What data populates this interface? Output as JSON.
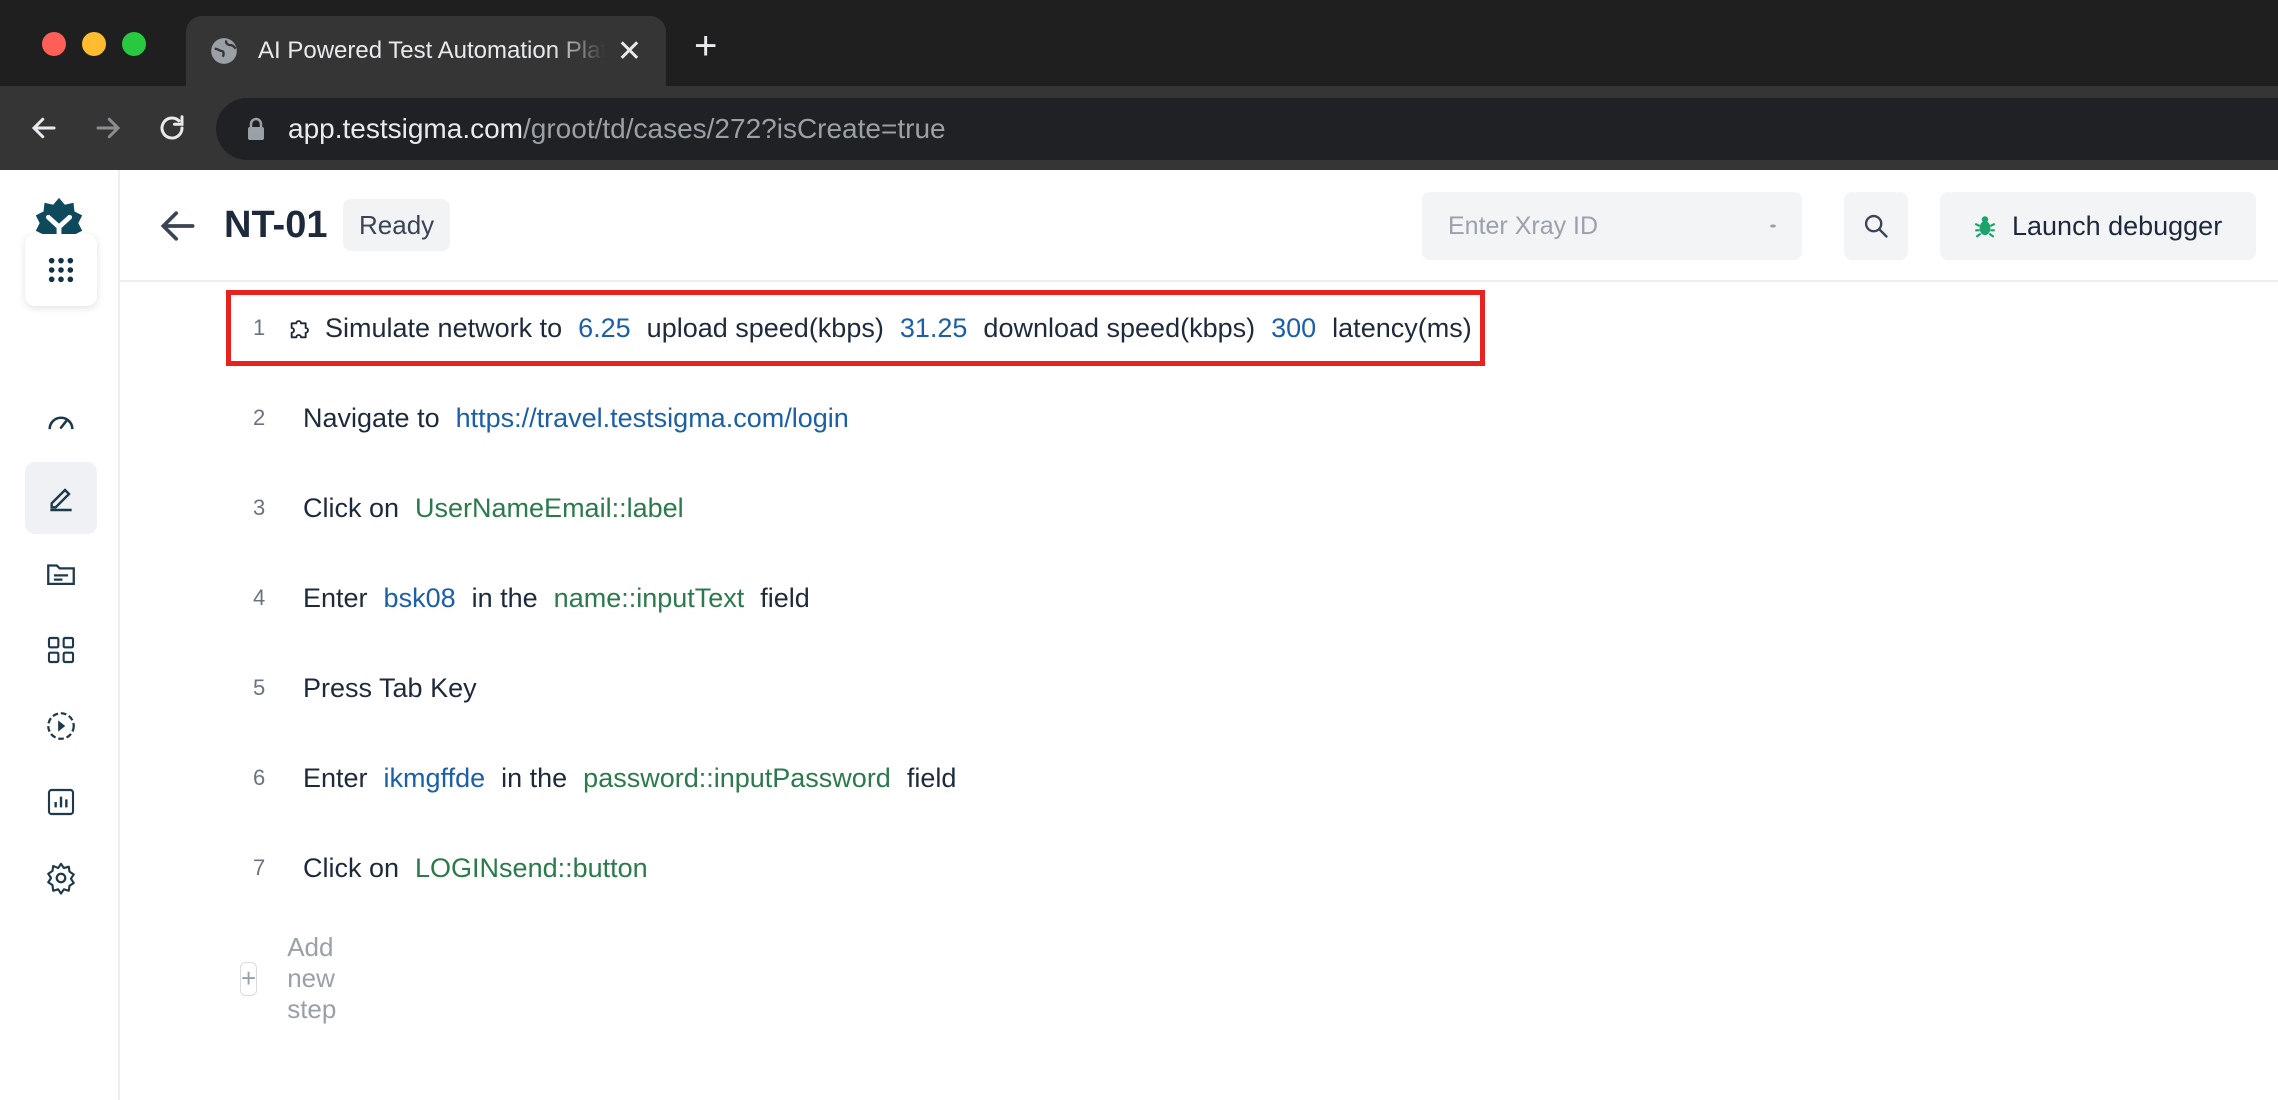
{
  "browser": {
    "tab_title": "AI Powered Test Automation Platform",
    "url_host": "app.testsigma.com",
    "url_path": "/groot/td/cases/272?isCreate=true"
  },
  "header": {
    "case_id": "NT-01",
    "status": "Ready",
    "xray_placeholder": "Enter Xray ID",
    "launch_debugger_label": "Launch debugger"
  },
  "sidebar": {
    "items": [
      {
        "name": "apps-menu",
        "icon": "grid-dots-icon"
      },
      {
        "name": "dashboard",
        "icon": "speedometer-icon"
      },
      {
        "name": "test-development",
        "icon": "pen-icon",
        "active": true
      },
      {
        "name": "test-data",
        "icon": "folder-icon"
      },
      {
        "name": "add-ons",
        "icon": "blocks-icon"
      },
      {
        "name": "runs",
        "icon": "play-circle-icon"
      },
      {
        "name": "reports",
        "icon": "chart-icon"
      },
      {
        "name": "settings",
        "icon": "gear-icon"
      }
    ]
  },
  "steps": [
    {
      "n": "1",
      "parts": [
        [
          "t",
          "Simulate network to"
        ],
        [
          "v",
          "6.25"
        ],
        [
          "t",
          "upload speed(kbps)"
        ],
        [
          "v",
          "31.25"
        ],
        [
          "t",
          "download speed(kbps)"
        ],
        [
          "v",
          "300"
        ],
        [
          "t",
          "latency(ms)"
        ]
      ],
      "addon": true,
      "selected": true
    },
    {
      "n": "2",
      "parts": [
        [
          "t",
          "Navigate to"
        ],
        [
          "v",
          "https://travel.testsigma.com/login"
        ]
      ]
    },
    {
      "n": "3",
      "parts": [
        [
          "t",
          "Click on"
        ],
        [
          "e",
          "UserNameEmail::label"
        ]
      ]
    },
    {
      "n": "4",
      "parts": [
        [
          "t",
          "Enter"
        ],
        [
          "v",
          "bsk08"
        ],
        [
          "t",
          "in the"
        ],
        [
          "e",
          "name::inputText"
        ],
        [
          "t",
          "field"
        ]
      ]
    },
    {
      "n": "5",
      "parts": [
        [
          "t",
          "Press Tab Key"
        ]
      ]
    },
    {
      "n": "6",
      "parts": [
        [
          "t",
          "Enter"
        ],
        [
          "v",
          "ikmgffde"
        ],
        [
          "t",
          "in the"
        ],
        [
          "e",
          "password::inputPassword"
        ],
        [
          "t",
          "field"
        ]
      ]
    },
    {
      "n": "7",
      "parts": [
        [
          "t",
          "Click on"
        ],
        [
          "e",
          "LOGINsend::button"
        ]
      ]
    }
  ],
  "add_step_label": "Add new step",
  "colors": {
    "value": "#1a5fa8",
    "element": "#2a7a4b",
    "highlight": "#e8231f",
    "brand": "#0f4a5c"
  }
}
